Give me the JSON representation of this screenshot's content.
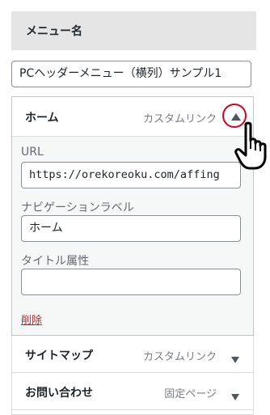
{
  "menu_name": {
    "label": "メニュー名",
    "value": "PCヘッダーメニュー（横列）サンプル1"
  },
  "expanded_item": {
    "title": "ホーム",
    "type": "カスタムリンク",
    "toggle_icon": "triangle-up-icon",
    "url_label": "URL",
    "url_value": "https://orekoreoku.com/affing",
    "nav_label_label": "ナビゲーションラベル",
    "nav_label_value": "ホーム",
    "title_attr_label": "タイトル属性",
    "title_attr_value": "",
    "delete_label": "削除"
  },
  "collapsed_items": [
    {
      "title": "サイトマップ",
      "type": "カスタムリンク"
    },
    {
      "title": "お問い合わせ",
      "type": "固定ページ"
    }
  ],
  "annotation": {
    "highlight_color": "#d7001f",
    "cursor_icon": "hand-pointer-icon"
  }
}
